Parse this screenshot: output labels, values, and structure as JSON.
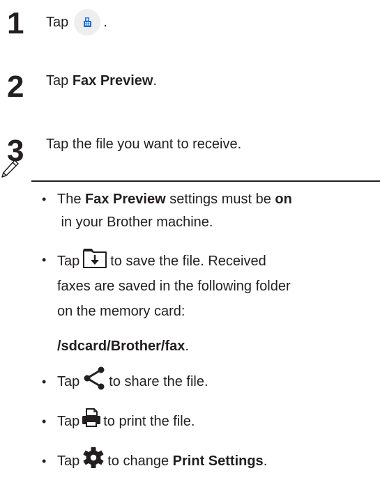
{
  "steps": [
    {
      "number": "1",
      "prefix": "Tap",
      "suffix": ".",
      "icon": "fax-app-icon"
    },
    {
      "number": "2",
      "prefix": "Tap ",
      "bold": "Fax Preview",
      "suffix": "."
    },
    {
      "number": "3",
      "text": "Tap the file you want to receive."
    }
  ],
  "notes": {
    "note1": {
      "pre": "The ",
      "bold1": "Fax Preview",
      "mid": " settings must be ",
      "bold2": "on",
      "post": " in your Brother machine."
    },
    "note2": {
      "pre": "Tap",
      "post": "to save the file. Received",
      "line2": "faxes are saved in the following folder",
      "line3": "on the memory card:",
      "path": "/sdcard/Brother/fax",
      "path_suffix": ".",
      "icon": "save-icon"
    },
    "note3": {
      "pre": "Tap",
      "post": "to share the file.",
      "icon": "share-icon"
    },
    "note4": {
      "pre": "Tap",
      "post": "to print the file.",
      "icon": "print-icon"
    },
    "note5": {
      "pre": "Tap",
      "post": "to change ",
      "bold": "Print Settings",
      "suffix": ".",
      "icon": "gear-icon"
    }
  },
  "colors": {
    "text": "#231f20",
    "accent": "#1f6fd1"
  }
}
